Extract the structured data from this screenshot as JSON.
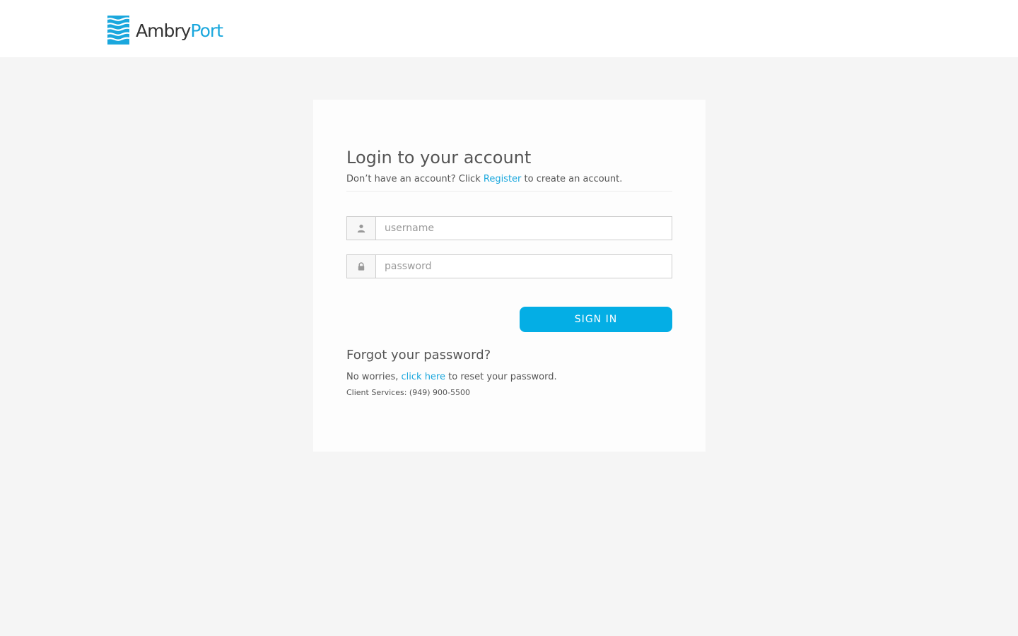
{
  "header": {
    "logo": {
      "name_part1": "Ambry",
      "name_part2": "Port",
      "icon": "waves-logo-icon",
      "colors": {
        "dark": "#333333",
        "accent": "#1aa7dd"
      }
    }
  },
  "login": {
    "title": "Login to your account",
    "subtitle_before": "Don’t have an account? Click ",
    "register_link": "Register",
    "subtitle_after": " to create an account.",
    "username": {
      "placeholder": "username",
      "value": "",
      "icon": "user-icon"
    },
    "password": {
      "placeholder": "password",
      "value": "",
      "icon": "lock-icon"
    },
    "signin_label": "SIGN IN",
    "signin_color": "#04aee5"
  },
  "forgot": {
    "title": "Forgot your password?",
    "text_before": "No worries, ",
    "link": "click here",
    "text_after": " to reset your password.",
    "client_services": "Client Services: (949) 900-5500"
  },
  "colors": {
    "page_bg": "#f5f5f5",
    "link": "#1aa7dd",
    "text": "#555555"
  }
}
